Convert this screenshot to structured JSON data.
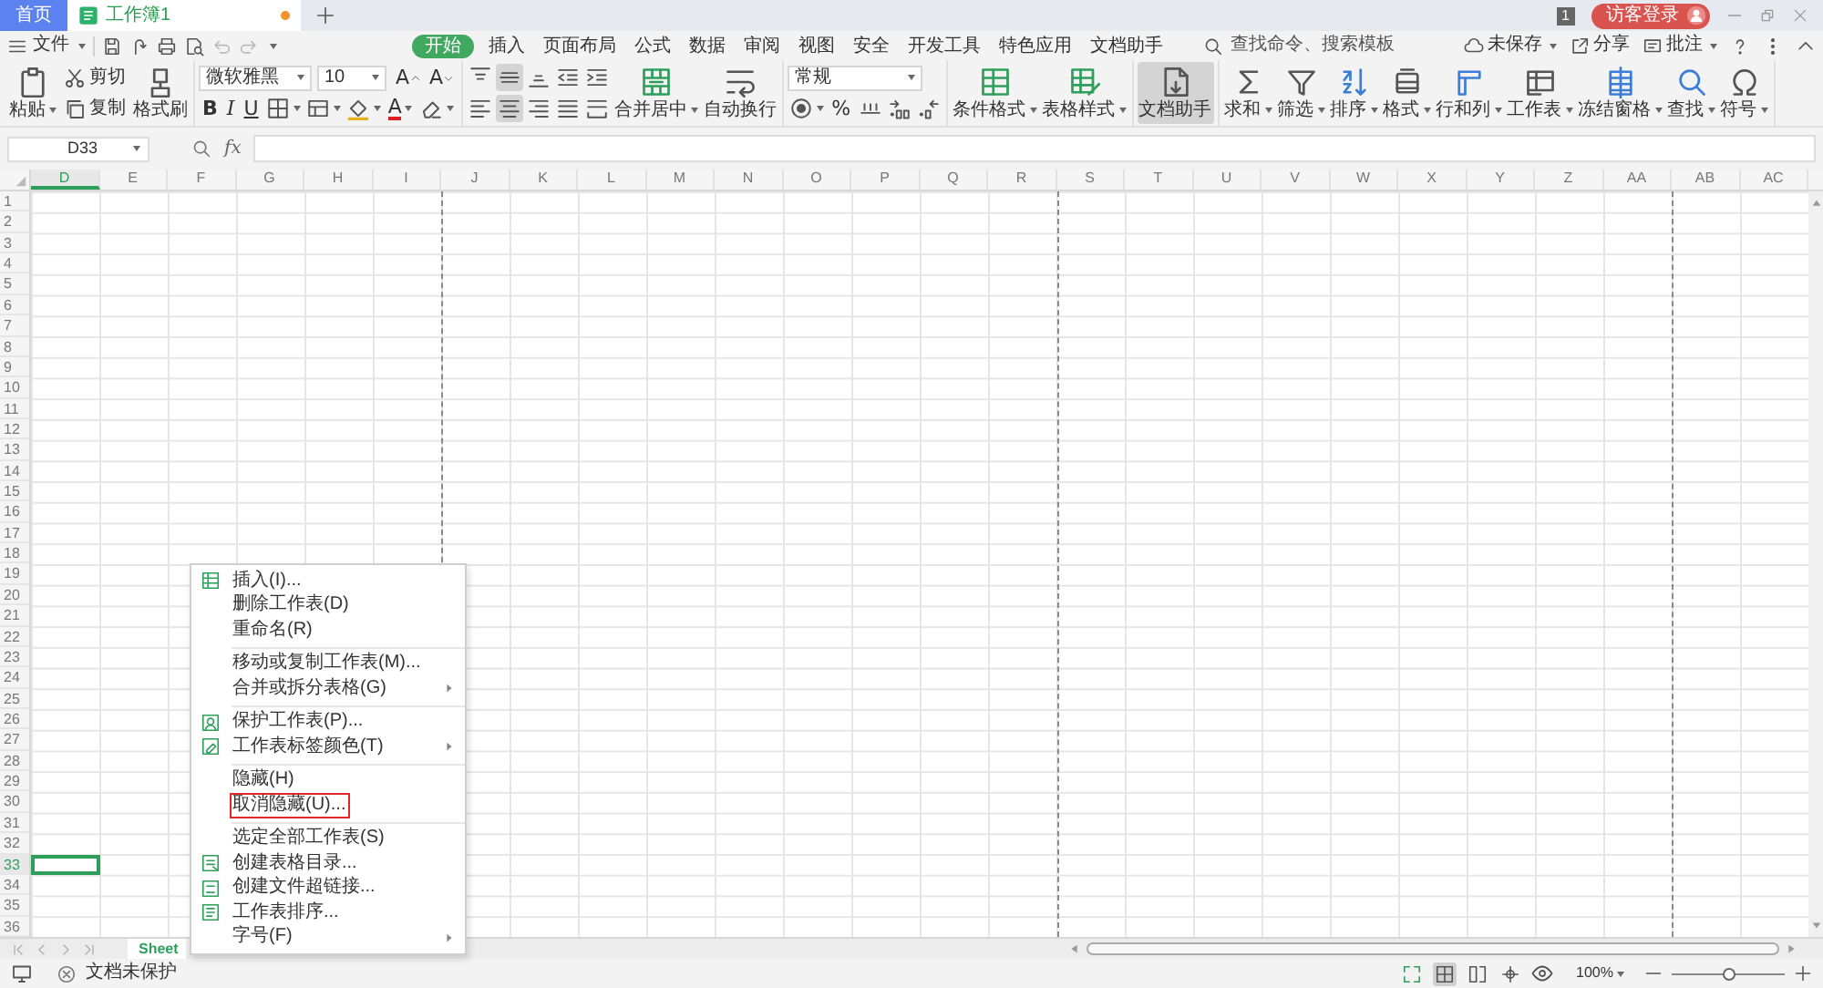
{
  "title_bar": {
    "tabs": [
      {
        "label": "首页",
        "kind": "home",
        "selected": false,
        "unsaved": false
      },
      {
        "label": "工作簿1",
        "kind": "document",
        "selected": true,
        "unsaved": true
      }
    ],
    "notification_count": "1",
    "login_button": "访客登录"
  },
  "menu_bar": {
    "file_menu": "文件",
    "ribbon_tabs": [
      {
        "label": "开始",
        "selected": true
      },
      {
        "label": "插入",
        "selected": false
      },
      {
        "label": "页面布局",
        "selected": false
      },
      {
        "label": "公式",
        "selected": false
      },
      {
        "label": "数据",
        "selected": false
      },
      {
        "label": "审阅",
        "selected": false
      },
      {
        "label": "视图",
        "selected": false
      },
      {
        "label": "安全",
        "selected": false
      },
      {
        "label": "开发工具",
        "selected": false
      },
      {
        "label": "特色应用",
        "selected": false
      },
      {
        "label": "文档助手",
        "selected": false
      }
    ],
    "search": {
      "placeholder": "查找命令、搜索模板"
    },
    "actions": [
      {
        "label": "未保存",
        "dropdown": true
      },
      {
        "label": "分享",
        "dropdown": false
      },
      {
        "label": "批注",
        "dropdown": true
      }
    ]
  },
  "ribbon": {
    "groups": [
      {
        "columns": [
          {
            "kind": "big",
            "label": "粘贴",
            "dropdown": true,
            "pressed": false
          },
          {
            "kind": "stack",
            "lines": [
              {
                "tools": [
                  {
                    "kind": "small",
                    "label": "剪切"
                  }
                ]
              },
              {
                "tools": [
                  {
                    "kind": "small",
                    "label": "复制"
                  }
                ]
              }
            ]
          },
          {
            "kind": "big",
            "label": "格式刷",
            "dropdown": false,
            "pressed": false
          }
        ]
      },
      {
        "columns": [
          {
            "kind": "stack",
            "lines": [
              {
                "tools": [
                  {
                    "kind": "field",
                    "value": "微软雅黑"
                  },
                  {
                    "kind": "field",
                    "value": "10"
                  },
                  {
                    "kind": "grow",
                    "label": "A",
                    "dropdown": false
                  },
                  {
                    "kind": "shrink",
                    "label": "A",
                    "dropdown": false
                  }
                ]
              },
              {
                "tools": [
                  {
                    "kind": "bold",
                    "label": "B",
                    "dropdown": false
                  },
                  {
                    "kind": "italic",
                    "label": "I",
                    "dropdown": false
                  },
                  {
                    "kind": "underline",
                    "label": "U",
                    "dropdown": false
                  },
                  {
                    "kind": "icon",
                    "dropdown": true,
                    "pressed": false
                  },
                  {
                    "kind": "icon",
                    "dropdown": true,
                    "pressed": false
                  },
                  {
                    "kind": "icon",
                    "dropdown": true,
                    "pressed": false
                  },
                  {
                    "kind": "colorletter",
                    "label": "A",
                    "dropdown": true
                  },
                  {
                    "kind": "icon",
                    "dropdown": true,
                    "pressed": false
                  }
                ]
              }
            ]
          }
        ]
      },
      {
        "columns": [
          {
            "kind": "stack",
            "lines": [
              {
                "tools": [
                  {
                    "kind": "icon",
                    "dropdown": false,
                    "pressed": false
                  },
                  {
                    "kind": "icon",
                    "dropdown": false,
                    "pressed": true
                  },
                  {
                    "kind": "icon",
                    "dropdown": false,
                    "pressed": false
                  },
                  {
                    "kind": "icon",
                    "dropdown": false,
                    "pressed": false
                  },
                  {
                    "kind": "icon",
                    "dropdown": false,
                    "pressed": false
                  }
                ]
              },
              {
                "tools": [
                  {
                    "kind": "icon",
                    "dropdown": false,
                    "pressed": false
                  },
                  {
                    "kind": "icon",
                    "dropdown": false,
                    "pressed": true
                  },
                  {
                    "kind": "icon",
                    "dropdown": false,
                    "pressed": false
                  },
                  {
                    "kind": "icon",
                    "dropdown": false,
                    "pressed": false
                  },
                  {
                    "kind": "icon",
                    "dropdown": false,
                    "pressed": false
                  }
                ]
              }
            ]
          },
          {
            "kind": "big",
            "label": "合并居中",
            "dropdown": true,
            "pressed": false
          },
          {
            "kind": "big",
            "label": "自动换行",
            "dropdown": false,
            "pressed": false
          }
        ]
      },
      {
        "columns": [
          {
            "kind": "stack",
            "lines": [
              {
                "tools": [
                  {
                    "kind": "field",
                    "value": "常规"
                  }
                ]
              },
              {
                "tools": [
                  {
                    "kind": "icon",
                    "dropdown": true,
                    "pressed": false
                  },
                  {
                    "kind": "letter",
                    "label": "%",
                    "dropdown": false
                  },
                  {
                    "kind": "icon",
                    "dropdown": false,
                    "pressed": false
                  },
                  {
                    "kind": "icon",
                    "dropdown": false,
                    "pressed": false
                  },
                  {
                    "kind": "icon",
                    "dropdown": false,
                    "pressed": false
                  }
                ]
              }
            ]
          }
        ]
      },
      {
        "columns": [
          {
            "kind": "big",
            "label": "条件格式",
            "dropdown": true,
            "pressed": false
          },
          {
            "kind": "big",
            "label": "表格样式",
            "dropdown": true,
            "pressed": false
          }
        ]
      },
      {
        "columns": [
          {
            "kind": "big",
            "label": "文档助手",
            "dropdown": false,
            "pressed": true
          }
        ]
      },
      {
        "columns": [
          {
            "kind": "big",
            "label": "求和",
            "dropdown": true,
            "pressed": false
          },
          {
            "kind": "big",
            "label": "筛选",
            "dropdown": true,
            "pressed": false
          },
          {
            "kind": "big",
            "label": "排序",
            "dropdown": true,
            "pressed": false
          },
          {
            "kind": "big",
            "label": "格式",
            "dropdown": true,
            "pressed": false
          },
          {
            "kind": "big",
            "label": "行和列",
            "dropdown": true,
            "pressed": false
          },
          {
            "kind": "big",
            "label": "工作表",
            "dropdown": true,
            "pressed": false
          },
          {
            "kind": "big",
            "label": "冻结窗格",
            "dropdown": true,
            "pressed": false
          },
          {
            "kind": "big",
            "label": "查找",
            "dropdown": true,
            "pressed": false
          },
          {
            "kind": "big",
            "label": "符号",
            "dropdown": true,
            "pressed": false
          }
        ]
      }
    ]
  },
  "formula_bar": {
    "name_box": "D33",
    "function_label": "fx"
  },
  "sheet": {
    "columns": [
      {
        "label": "D",
        "selected": true,
        "page_break": false
      },
      {
        "label": "E",
        "selected": false,
        "page_break": false
      },
      {
        "label": "F",
        "selected": false,
        "page_break": false
      },
      {
        "label": "G",
        "selected": false,
        "page_break": false
      },
      {
        "label": "H",
        "selected": false,
        "page_break": false
      },
      {
        "label": "I",
        "selected": false,
        "page_break": false
      },
      {
        "label": "J",
        "selected": false,
        "page_break": true
      },
      {
        "label": "K",
        "selected": false,
        "page_break": false
      },
      {
        "label": "L",
        "selected": false,
        "page_break": false
      },
      {
        "label": "M",
        "selected": false,
        "page_break": false
      },
      {
        "label": "N",
        "selected": false,
        "page_break": false
      },
      {
        "label": "O",
        "selected": false,
        "page_break": false
      },
      {
        "label": "P",
        "selected": false,
        "page_break": false
      },
      {
        "label": "Q",
        "selected": false,
        "page_break": false
      },
      {
        "label": "R",
        "selected": false,
        "page_break": false
      },
      {
        "label": "S",
        "selected": false,
        "page_break": true
      },
      {
        "label": "T",
        "selected": false,
        "page_break": false
      },
      {
        "label": "U",
        "selected": false,
        "page_break": false
      },
      {
        "label": "V",
        "selected": false,
        "page_break": false
      },
      {
        "label": "W",
        "selected": false,
        "page_break": false
      },
      {
        "label": "X",
        "selected": false,
        "page_break": false
      },
      {
        "label": "Y",
        "selected": false,
        "page_break": false
      },
      {
        "label": "Z",
        "selected": false,
        "page_break": false
      },
      {
        "label": "AA",
        "selected": false,
        "page_break": false
      },
      {
        "label": "AB",
        "selected": false,
        "page_break": true
      },
      {
        "label": "AC",
        "selected": false,
        "page_break": false
      }
    ],
    "rows": [
      {
        "label": "1",
        "selected": false
      },
      {
        "label": "2",
        "selected": false
      },
      {
        "label": "3",
        "selected": false
      },
      {
        "label": "4",
        "selected": false
      },
      {
        "label": "5",
        "selected": false
      },
      {
        "label": "6",
        "selected": false
      },
      {
        "label": "7",
        "selected": false
      },
      {
        "label": "8",
        "selected": false
      },
      {
        "label": "9",
        "selected": false
      },
      {
        "label": "10",
        "selected": false
      },
      {
        "label": "11",
        "selected": false
      },
      {
        "label": "12",
        "selected": false
      },
      {
        "label": "13",
        "selected": false
      },
      {
        "label": "14",
        "selected": false
      },
      {
        "label": "15",
        "selected": false
      },
      {
        "label": "16",
        "selected": false
      },
      {
        "label": "17",
        "selected": false
      },
      {
        "label": "18",
        "selected": false
      },
      {
        "label": "19",
        "selected": false
      },
      {
        "label": "20",
        "selected": false
      },
      {
        "label": "21",
        "selected": false
      },
      {
        "label": "22",
        "selected": false
      },
      {
        "label": "23",
        "selected": false
      },
      {
        "label": "24",
        "selected": false
      },
      {
        "label": "25",
        "selected": false
      },
      {
        "label": "26",
        "selected": false
      },
      {
        "label": "27",
        "selected": false
      },
      {
        "label": "28",
        "selected": false
      },
      {
        "label": "29",
        "selected": false
      },
      {
        "label": "30",
        "selected": false
      },
      {
        "label": "31",
        "selected": false
      },
      {
        "label": "32",
        "selected": false
      },
      {
        "label": "33",
        "selected": true
      },
      {
        "label": "34",
        "selected": false
      },
      {
        "label": "35",
        "selected": false
      },
      {
        "label": "36",
        "selected": false
      }
    ]
  },
  "context_menu": {
    "sections": [
      [
        {
          "label": "插入(I)...",
          "submenu": false,
          "outlined": false
        },
        {
          "label": "删除工作表(D)",
          "submenu": false,
          "outlined": false
        },
        {
          "label": "重命名(R)",
          "submenu": false,
          "outlined": false
        }
      ],
      [
        {
          "label": "移动或复制工作表(M)...",
          "submenu": false,
          "outlined": false
        },
        {
          "label": "合并或拆分表格(G)",
          "submenu": true,
          "outlined": false
        }
      ],
      [
        {
          "label": "保护工作表(P)...",
          "submenu": false,
          "outlined": false
        },
        {
          "label": "工作表标签颜色(T)",
          "submenu": true,
          "outlined": false
        }
      ],
      [
        {
          "label": "隐藏(H)",
          "submenu": false,
          "outlined": false
        },
        {
          "label": "取消隐藏(U)...",
          "submenu": false,
          "outlined": true
        }
      ],
      [
        {
          "label": "选定全部工作表(S)",
          "submenu": false,
          "outlined": false
        },
        {
          "label": "创建表格目录...",
          "submenu": false,
          "outlined": false
        },
        {
          "label": "创建文件超链接...",
          "submenu": false,
          "outlined": false
        },
        {
          "label": "工作表排序...",
          "submenu": false,
          "outlined": false
        },
        {
          "label": "字号(F)",
          "submenu": true,
          "outlined": false
        }
      ]
    ]
  },
  "sheet_tabs": [
    {
      "label": "Sheet",
      "selected": true
    }
  ],
  "status_bar": {
    "protection": "文档未保护",
    "view_buttons": [
      {
        "selected": false
      },
      {
        "selected": true
      },
      {
        "selected": false
      },
      {
        "selected": false
      }
    ],
    "zoom": "100%",
    "zoom_slider": {
      "level": 0.5
    }
  }
}
